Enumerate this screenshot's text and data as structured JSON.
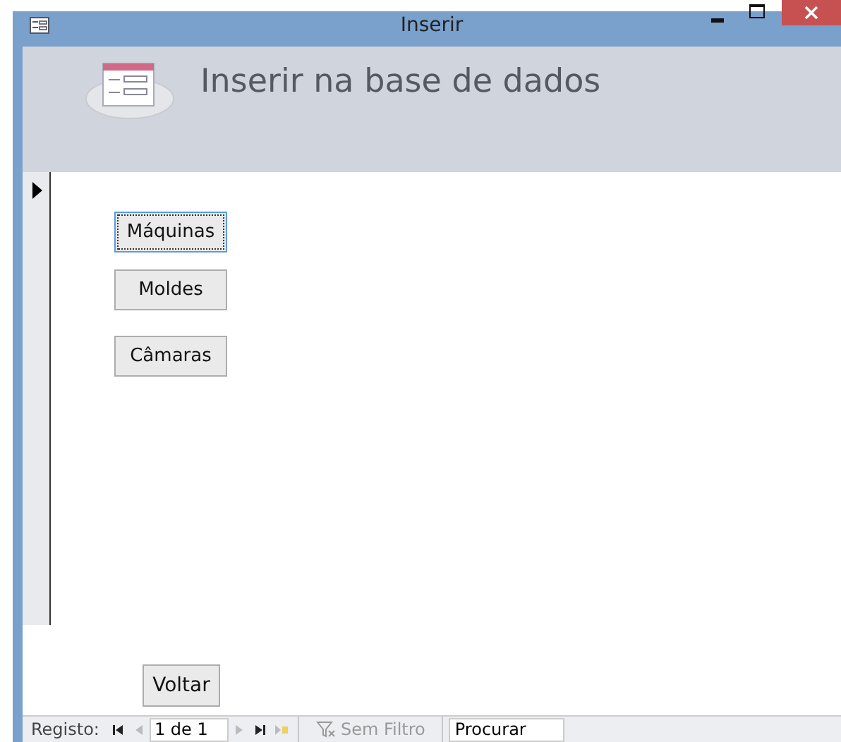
{
  "window": {
    "title": "Inserir"
  },
  "header": {
    "title": "Inserir na base de dados"
  },
  "buttons": [
    {
      "label": "Máquinas",
      "focused": true
    },
    {
      "label": "Moldes",
      "focused": false
    },
    {
      "label": "Câmaras",
      "focused": false
    }
  ],
  "back_button": {
    "label": "Voltar"
  },
  "status_bar": {
    "label": "Registo:",
    "record": "1 de 1",
    "nav": [
      {
        "kind": "first",
        "disabled": false
      },
      {
        "kind": "prev",
        "disabled": true
      },
      {
        "kind": "next",
        "disabled": true
      },
      {
        "kind": "last",
        "disabled": false
      },
      {
        "kind": "new",
        "disabled": true
      }
    ],
    "filter": {
      "label": "Sem Filtro",
      "disabled": true
    },
    "search": {
      "placeholder": "Procurar"
    }
  }
}
